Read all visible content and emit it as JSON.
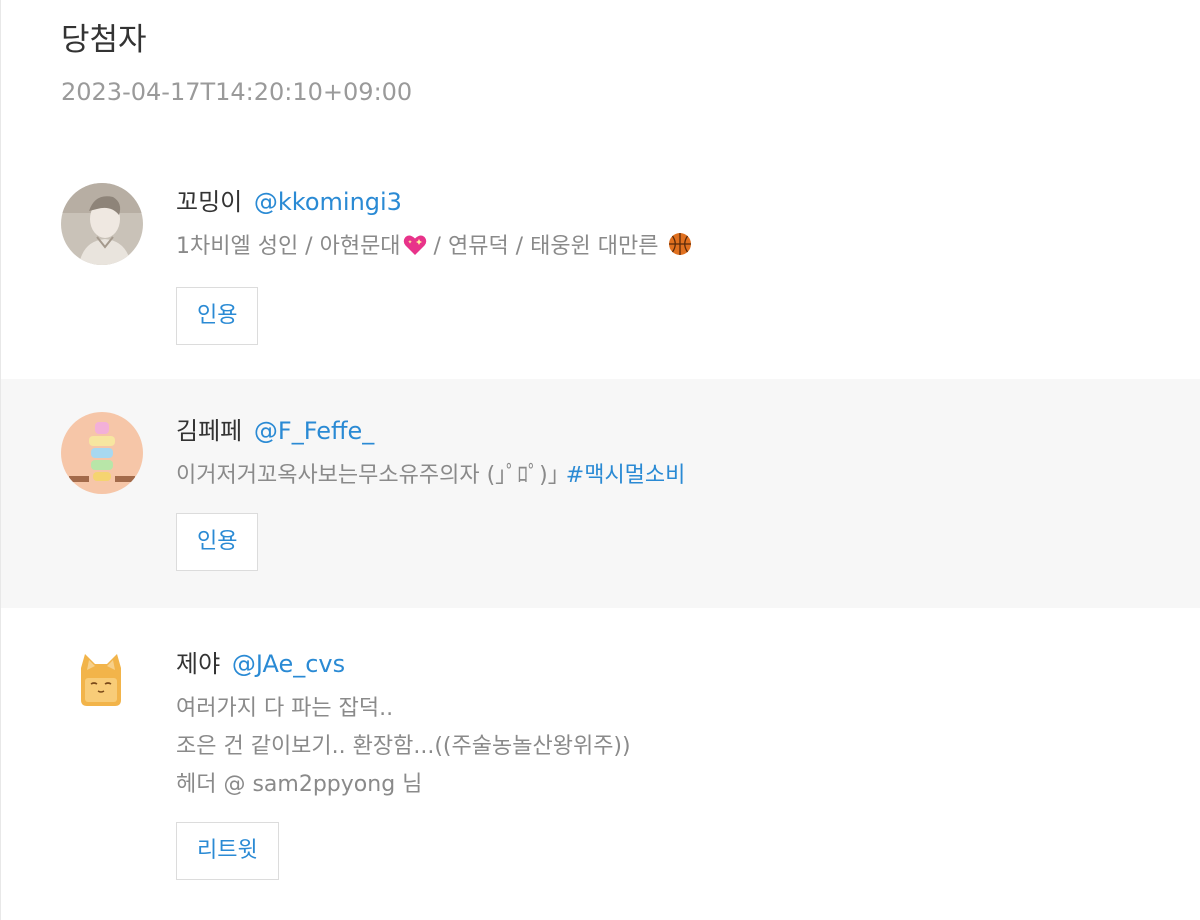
{
  "page": {
    "title": "당첨자",
    "timestamp": "2023-04-17T14:20:10+09:00"
  },
  "winners": [
    {
      "display_name": "꼬밍이",
      "handle": "@kkomingi3",
      "bio_text": "1차비엘 성인 / 아현문대",
      "bio_text_2": " / 연뮤덕 / 태웅윈 대만른 ",
      "bio_emojis": [
        "sparkling-heart-icon",
        "basketball-icon"
      ],
      "action_label": "인용"
    },
    {
      "display_name": "김페페",
      "handle": "@F_Feffe_",
      "bio_text": "이거저거꼬옥사보는무소유주의자 (｣ﾟﾛﾟ)｣ ",
      "hashtag": "#맥시멀소비",
      "action_label": "인용"
    },
    {
      "display_name": "제야",
      "handle": "@JAe_cvs",
      "bio_lines": [
        "여러가지 다 파는 잡덕..",
        "조은 건 같이보기.. 환장함...((주술농놀산왕위주))",
        "헤더 @ sam2ppyong 님"
      ],
      "action_label": "리트윗"
    }
  ],
  "colors": {
    "link_blue": "#2a8ad4",
    "text_dark": "#333333",
    "text_grey": "#8a8a8a",
    "alt_row_bg": "#f7f7f7"
  }
}
